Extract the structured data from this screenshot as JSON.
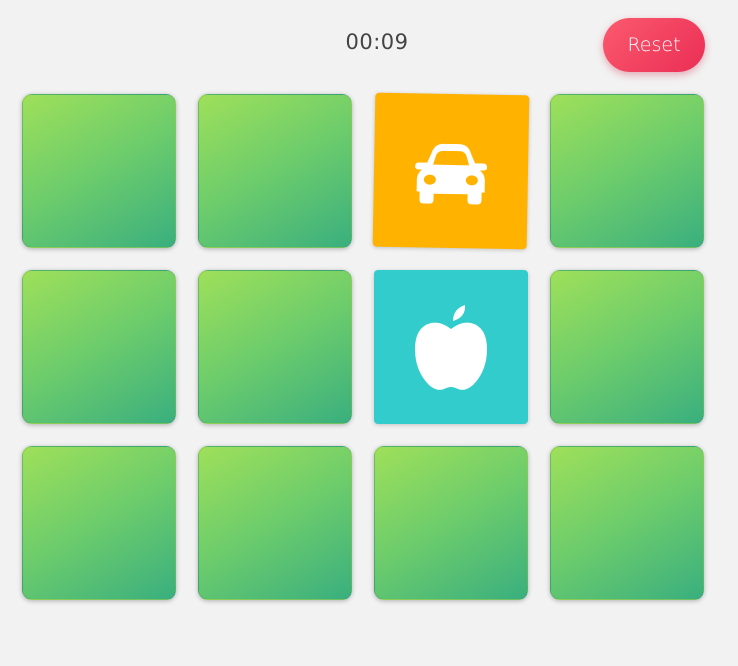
{
  "header": {
    "timer": "00:09",
    "reset_label": "Reset"
  },
  "colors": {
    "background": "#f2f2f2",
    "card_back_gradient": [
      "#9ee05a",
      "#3aaf7e"
    ],
    "reset_button": "#ef3a5d"
  },
  "cards": [
    {
      "state": "hidden"
    },
    {
      "state": "hidden"
    },
    {
      "state": "revealed",
      "icon": "car-icon",
      "color": "#ffb300"
    },
    {
      "state": "hidden"
    },
    {
      "state": "hidden"
    },
    {
      "state": "hidden"
    },
    {
      "state": "revealed",
      "icon": "apple-icon",
      "color": "#33cccc"
    },
    {
      "state": "hidden"
    },
    {
      "state": "hidden"
    },
    {
      "state": "hidden"
    },
    {
      "state": "hidden"
    },
    {
      "state": "hidden"
    }
  ]
}
